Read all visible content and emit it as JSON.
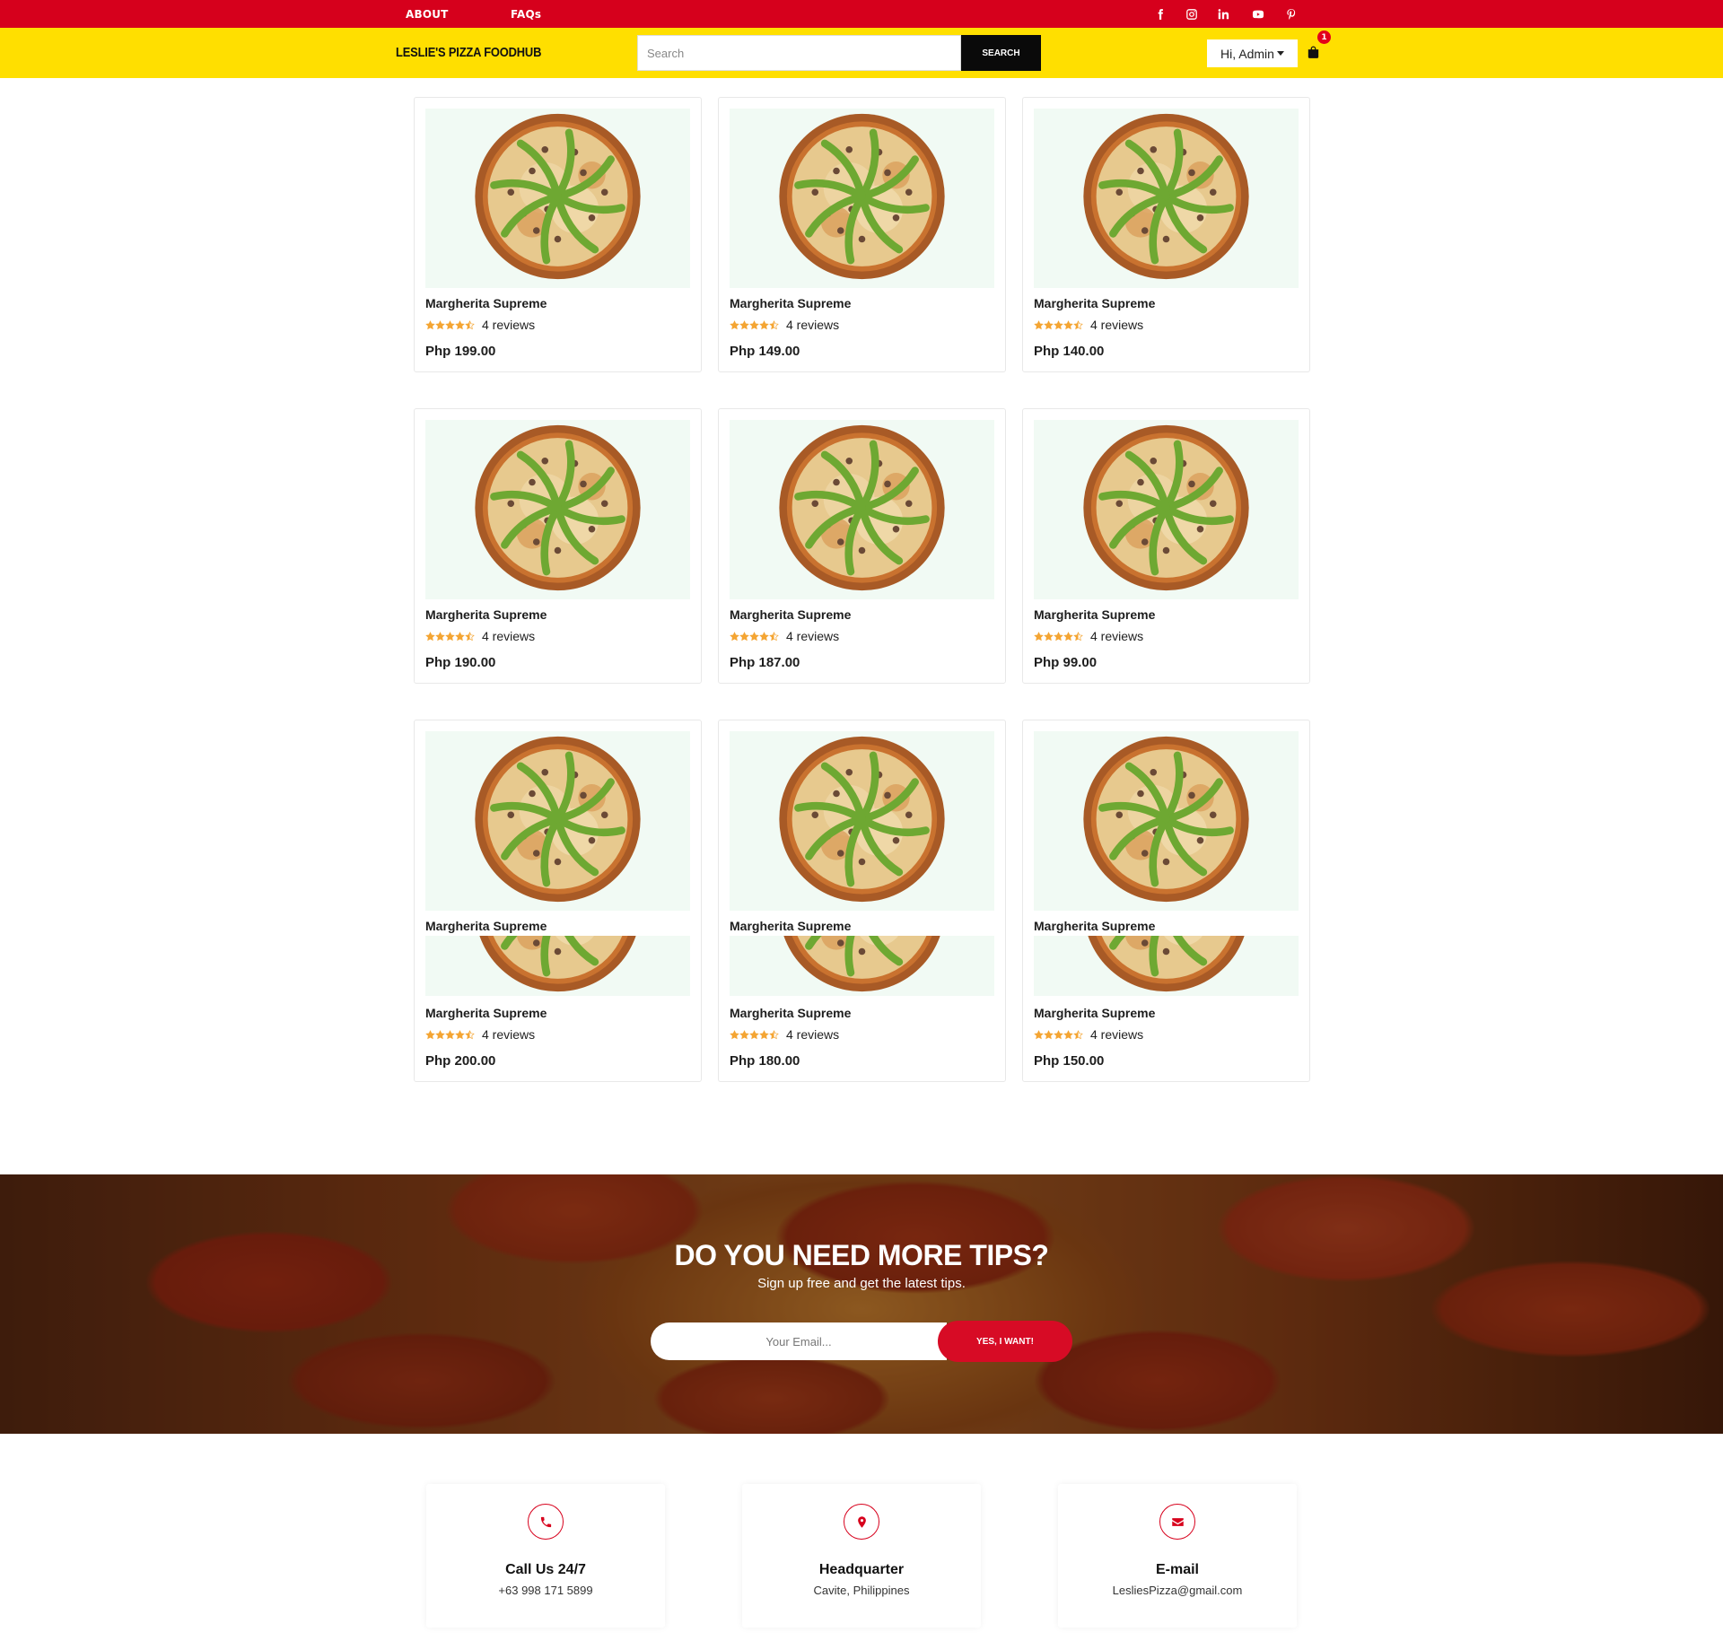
{
  "topbar": {
    "about": "ABOUT",
    "faqs": "FAQs",
    "social": [
      "facebook-icon",
      "instagram-icon",
      "linkedin-icon",
      "youtube-icon",
      "pinterest-icon"
    ]
  },
  "header": {
    "brand": "LESLIE'S PIZZA FOODHUB",
    "search_placeholder": "Search",
    "search_button": "SEARCH",
    "user_label": "Hi, Admin",
    "cart_count": "1"
  },
  "products": [
    {
      "name": "Margherita Supreme",
      "reviews": "4 reviews",
      "price": "Php 199.00",
      "rating": 4.5
    },
    {
      "name": "Margherita Supreme",
      "reviews": "4 reviews",
      "price": "Php 149.00",
      "rating": 4.5
    },
    {
      "name": "Margherita Supreme",
      "reviews": "4 reviews",
      "price": "Php 140.00",
      "rating": 4.5
    },
    {
      "name": "Margherita Supreme",
      "reviews": "4 reviews",
      "price": "Php 190.00",
      "rating": 4.5
    },
    {
      "name": "Margherita Supreme",
      "reviews": "4 reviews",
      "price": "Php 187.00",
      "rating": 4.5
    },
    {
      "name": "Margherita Supreme",
      "reviews": "4 reviews",
      "price": "Php 99.00",
      "rating": 4.5
    },
    {
      "name": "Margherita Supreme",
      "reviews": "4 reviews",
      "price": "Php 200.00",
      "rating": 4.5
    },
    {
      "name": "Margherita Supreme",
      "reviews": "4 reviews",
      "price": "Php 180.00",
      "rating": 4.5
    },
    {
      "name": "Margherita Supreme",
      "reviews": "4 reviews",
      "price": "Php 150.00",
      "rating": 4.5
    }
  ],
  "newsletter": {
    "title": "DO YOU NEED MORE TIPS?",
    "subtitle": "Sign up free and get the latest tips.",
    "email_placeholder": "Your Email...",
    "button": "YES, I WANT!"
  },
  "contacts": [
    {
      "icon": "phone-icon",
      "title": "Call Us 24/7",
      "value": "+63 998 171 5899"
    },
    {
      "icon": "map-pin-icon",
      "title": "Headquarter",
      "value": "Cavite, Philippines"
    },
    {
      "icon": "envelope-icon",
      "title": "E-mail",
      "value": "LesliesPizza@gmail.com"
    }
  ],
  "colors": {
    "topbar": "#d6001c",
    "header": "#ffdf00",
    "accent": "#d70b25",
    "star": "#f4a533"
  }
}
